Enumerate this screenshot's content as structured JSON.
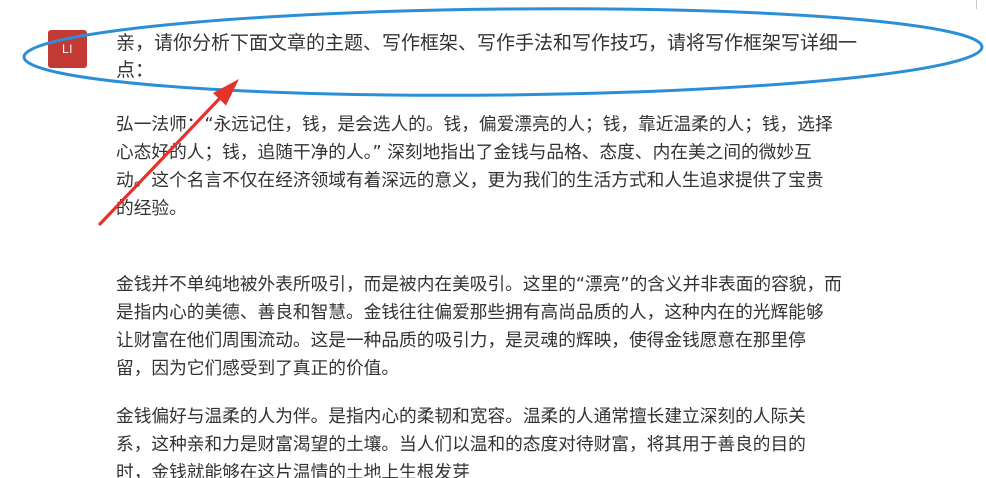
{
  "colors": {
    "text": "#333333",
    "avatar_bg": "#c23a33",
    "avatar_text": "#ffffff",
    "highlight_ellipse": "#2b8fd8",
    "annotation_arrow": "#e5322a"
  },
  "annotations": {
    "highlight": "ellipse-outline",
    "pointer": "red-arrow-icon"
  },
  "message": {
    "avatar_label": "LI",
    "lines": [
      "亲，请你分析下面文章的主题、写作框架、写作手法和写作技巧，请将写作框架写详细一",
      "点："
    ]
  },
  "article": {
    "paragraphs": [
      {
        "lines": [
          "弘一法师：“永远记住，钱，是会选人的。钱，偏爱漂亮的人；钱，靠近温柔的人；钱，选择",
          "心态好的人；钱，追随干净的人。” 深刻地指出了金钱与品格、态度、内在美之间的微妙互",
          "动。这个名言不仅在经济领域有着深远的意义，更为我们的生活方式和人生追求提供了宝贵",
          "的经验。"
        ]
      },
      {
        "lines": [
          "金钱并不单纯地被外表所吸引，而是被内在美吸引。这里的“漂亮”的含义并非表面的容貌，而",
          "是指内心的美德、善良和智慧。金钱往往偏爱那些拥有高尚品质的人，这种内在的光辉能够",
          "让财富在他们周围流动。这是一种品质的吸引力，是灵魂的辉映，使得金钱愿意在那里停",
          "留，因为它们感受到了真正的价值。"
        ]
      },
      {
        "lines": [
          "金钱偏好与温柔的人为伴。是指内心的柔韧和宽容。温柔的人通常擅长建立深刻的人际关",
          "系，这种亲和力是财富渴望的土壤。当人们以温和的态度对待财富，将其用于善良的目的",
          "时，金钱就能够在这片温情的土地上生根发芽"
        ]
      }
    ]
  }
}
